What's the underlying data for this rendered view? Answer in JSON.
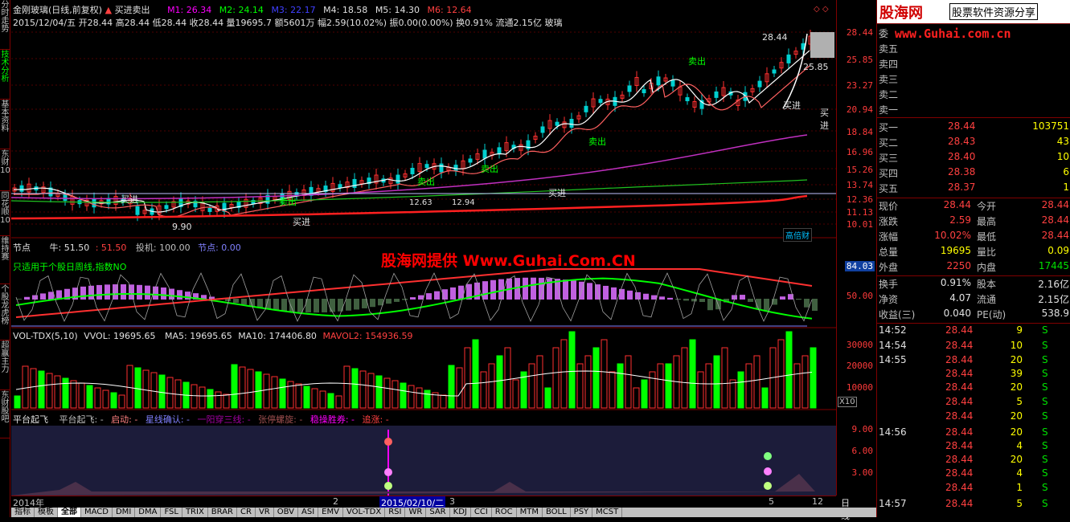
{
  "left_tabs": [
    {
      "label": "分时走势",
      "active": false
    },
    {
      "label": "技术分析",
      "active": true
    },
    {
      "label": "基本资料",
      "active": false
    },
    {
      "label": "东财10",
      "active": false
    },
    {
      "label": "同花顺10",
      "active": false
    },
    {
      "label": "维持赛",
      "active": false
    },
    {
      "label": "个股龙虎榜",
      "active": false
    },
    {
      "label": "超赢主力",
      "active": false
    },
    {
      "label": "东财股吧",
      "active": false
    }
  ],
  "kline": {
    "title": "金刚玻璃(日线,前复权)",
    "indicator": "买进卖出",
    "ma": [
      {
        "label": "M1: 26.34",
        "color": "#ff00ff"
      },
      {
        "label": "M2: 24.14",
        "color": "#00ff00"
      },
      {
        "label": "M3: 22.17",
        "color": "#4040ff"
      },
      {
        "label": "M4: 18.58",
        "color": "#e0e0e0"
      },
      {
        "label": "M5: 14.30",
        "color": "#e0e0e0"
      },
      {
        "label": "M6: 12.64",
        "color": "#ff4040"
      }
    ],
    "info_date": "2015/12/04/五",
    "info": "开28.44 高28.44 低28.44 收28.44 量19695.7 额5601万 幅2.59(10.02%) 振0.00(0.00%) 换0.91% 流通2.15亿 玻璃",
    "yticks": [
      "28.44",
      "25.85",
      "23.27",
      "20.94",
      "18.84",
      "16.96",
      "15.26",
      "13.74",
      "12.36",
      "11.13",
      "10.01"
    ],
    "annot_high": "28.44",
    "annot_25": "25.85",
    "annot_low": "9.90",
    "annot_1263": "12.63",
    "annot_1294": "12.94",
    "buy": "买进",
    "sell": "卖出",
    "high_btn": "高倍财"
  },
  "osc": {
    "title": "节点",
    "bull": "牛: 51.50",
    "bull2": ": 51.50",
    "spec": "投机: 100.00",
    "node": "节点: 0.00",
    "note": "只适用于个股日周线,指数NO",
    "yticks": [
      "84.03",
      "50.00"
    ]
  },
  "vol": {
    "title": "VOL-TDX(5,10)",
    "vvol": "VVOL: 19695.65",
    "ma5": "MA5: 19695.65",
    "ma10": "MA10: 174406.80",
    "mavol2": "MAVOL2: 154936.59",
    "yticks": [
      "30000",
      "20000",
      "10000"
    ],
    "unit": "X10"
  },
  "pt": {
    "title": "平台起飞",
    "items": [
      {
        "label": "平台起飞: -",
        "color": "#c0c0c0"
      },
      {
        "label": "启动: -",
        "color": "#ff8080"
      },
      {
        "label": "星线确认: -",
        "color": "#8080ff"
      },
      {
        "label": "一阳穿三线: -",
        "color": "#a000a0"
      },
      {
        "label": "张停螺旋: -",
        "color": "#a05050"
      },
      {
        "label": "稳操胜券: -",
        "color": "#ff00ff"
      },
      {
        "label": "追涨: -",
        "color": "#ff4040"
      }
    ],
    "yticks": [
      "9.00",
      "6.00",
      "3.00"
    ]
  },
  "dates": {
    "y2014": "2014年",
    "m2": "2",
    "sel": "2015/02/10/二",
    "m3": "3",
    "m5": "5",
    "m12": "12",
    "period": "日线"
  },
  "tabs": [
    "指标",
    "模板",
    "全部",
    "MACD",
    "DMI",
    "DMA",
    "FSL",
    "TRIX",
    "BRAR",
    "CR",
    "VR",
    "OBV",
    "ASI",
    "EMV",
    "VOL-TDX",
    "RSI",
    "WR",
    "SAR",
    "KDJ",
    "CCI",
    "ROC",
    "MTM",
    "BOLL",
    "PSY",
    "MCST"
  ],
  "active_tab": "全部",
  "watermark": "股海网提供 Www.Guhai.Com.CN",
  "logo": {
    "name": "股海网",
    "slogan": "股票软件资源分享",
    "url": "www.Guhai.com.cn"
  },
  "order": {
    "wei": "委",
    "sells": [
      {
        "label": "卖五"
      },
      {
        "label": "卖四"
      },
      {
        "label": "卖三"
      },
      {
        "label": "卖二"
      },
      {
        "label": "卖一"
      }
    ],
    "buys": [
      {
        "label": "买一",
        "price": "28.44",
        "vol": "103751"
      },
      {
        "label": "买二",
        "price": "28.43",
        "vol": "43"
      },
      {
        "label": "买三",
        "price": "28.40",
        "vol": "10"
      },
      {
        "label": "买四",
        "price": "28.38",
        "vol": "6"
      },
      {
        "label": "买五",
        "price": "28.37",
        "vol": "1"
      }
    ]
  },
  "quote": [
    {
      "l1": "现价",
      "v1": "28.44",
      "c1": "red",
      "l2": "今开",
      "v2": "28.44",
      "c2": "red"
    },
    {
      "l1": "涨跌",
      "v1": "2.59",
      "c1": "red",
      "l2": "最高",
      "v2": "28.44",
      "c2": "red"
    },
    {
      "l1": "涨幅",
      "v1": "10.02%",
      "c1": "red",
      "l2": "最低",
      "v2": "28.44",
      "c2": "red"
    },
    {
      "l1": "总量",
      "v1": "19695",
      "c1": "yel",
      "l2": "量比",
      "v2": "0.09",
      "c2": "yel"
    },
    {
      "l1": "外盘",
      "v1": "2250",
      "c1": "red",
      "l2": "内盘",
      "v2": "17445",
      "c2": "green"
    }
  ],
  "fund": [
    {
      "l1": "换手",
      "v1": "0.91%",
      "l2": "股本",
      "v2": "2.16亿"
    },
    {
      "l1": "净资",
      "v1": "4.07",
      "l2": "流通",
      "v2": "2.15亿"
    },
    {
      "l1": "收益(三)",
      "v1": "0.040",
      "l2": "PE(动)",
      "v2": "538.9"
    }
  ],
  "ticks": [
    {
      "t": "14:52",
      "p": "28.44",
      "v": "9",
      "s": "S"
    },
    {
      "t": "14:54",
      "p": "28.44",
      "v": "10",
      "s": "S"
    },
    {
      "t": "14:55",
      "p": "28.44",
      "v": "20",
      "s": "S"
    },
    {
      "t": "",
      "p": "28.44",
      "v": "39",
      "s": "S"
    },
    {
      "t": "",
      "p": "28.44",
      "v": "20",
      "s": "S"
    },
    {
      "t": "",
      "p": "28.44",
      "v": "5",
      "s": "S"
    },
    {
      "t": "",
      "p": "28.44",
      "v": "20",
      "s": "S"
    },
    {
      "t": "14:56",
      "p": "28.44",
      "v": "20",
      "s": "S"
    },
    {
      "t": "",
      "p": "28.44",
      "v": "4",
      "s": "S"
    },
    {
      "t": "",
      "p": "28.44",
      "v": "20",
      "s": "S"
    },
    {
      "t": "",
      "p": "28.44",
      "v": "4",
      "s": "S"
    },
    {
      "t": "",
      "p": "28.44",
      "v": "1",
      "s": "S"
    },
    {
      "t": "14:57",
      "p": "28.44",
      "v": "5",
      "s": "S"
    }
  ]
}
